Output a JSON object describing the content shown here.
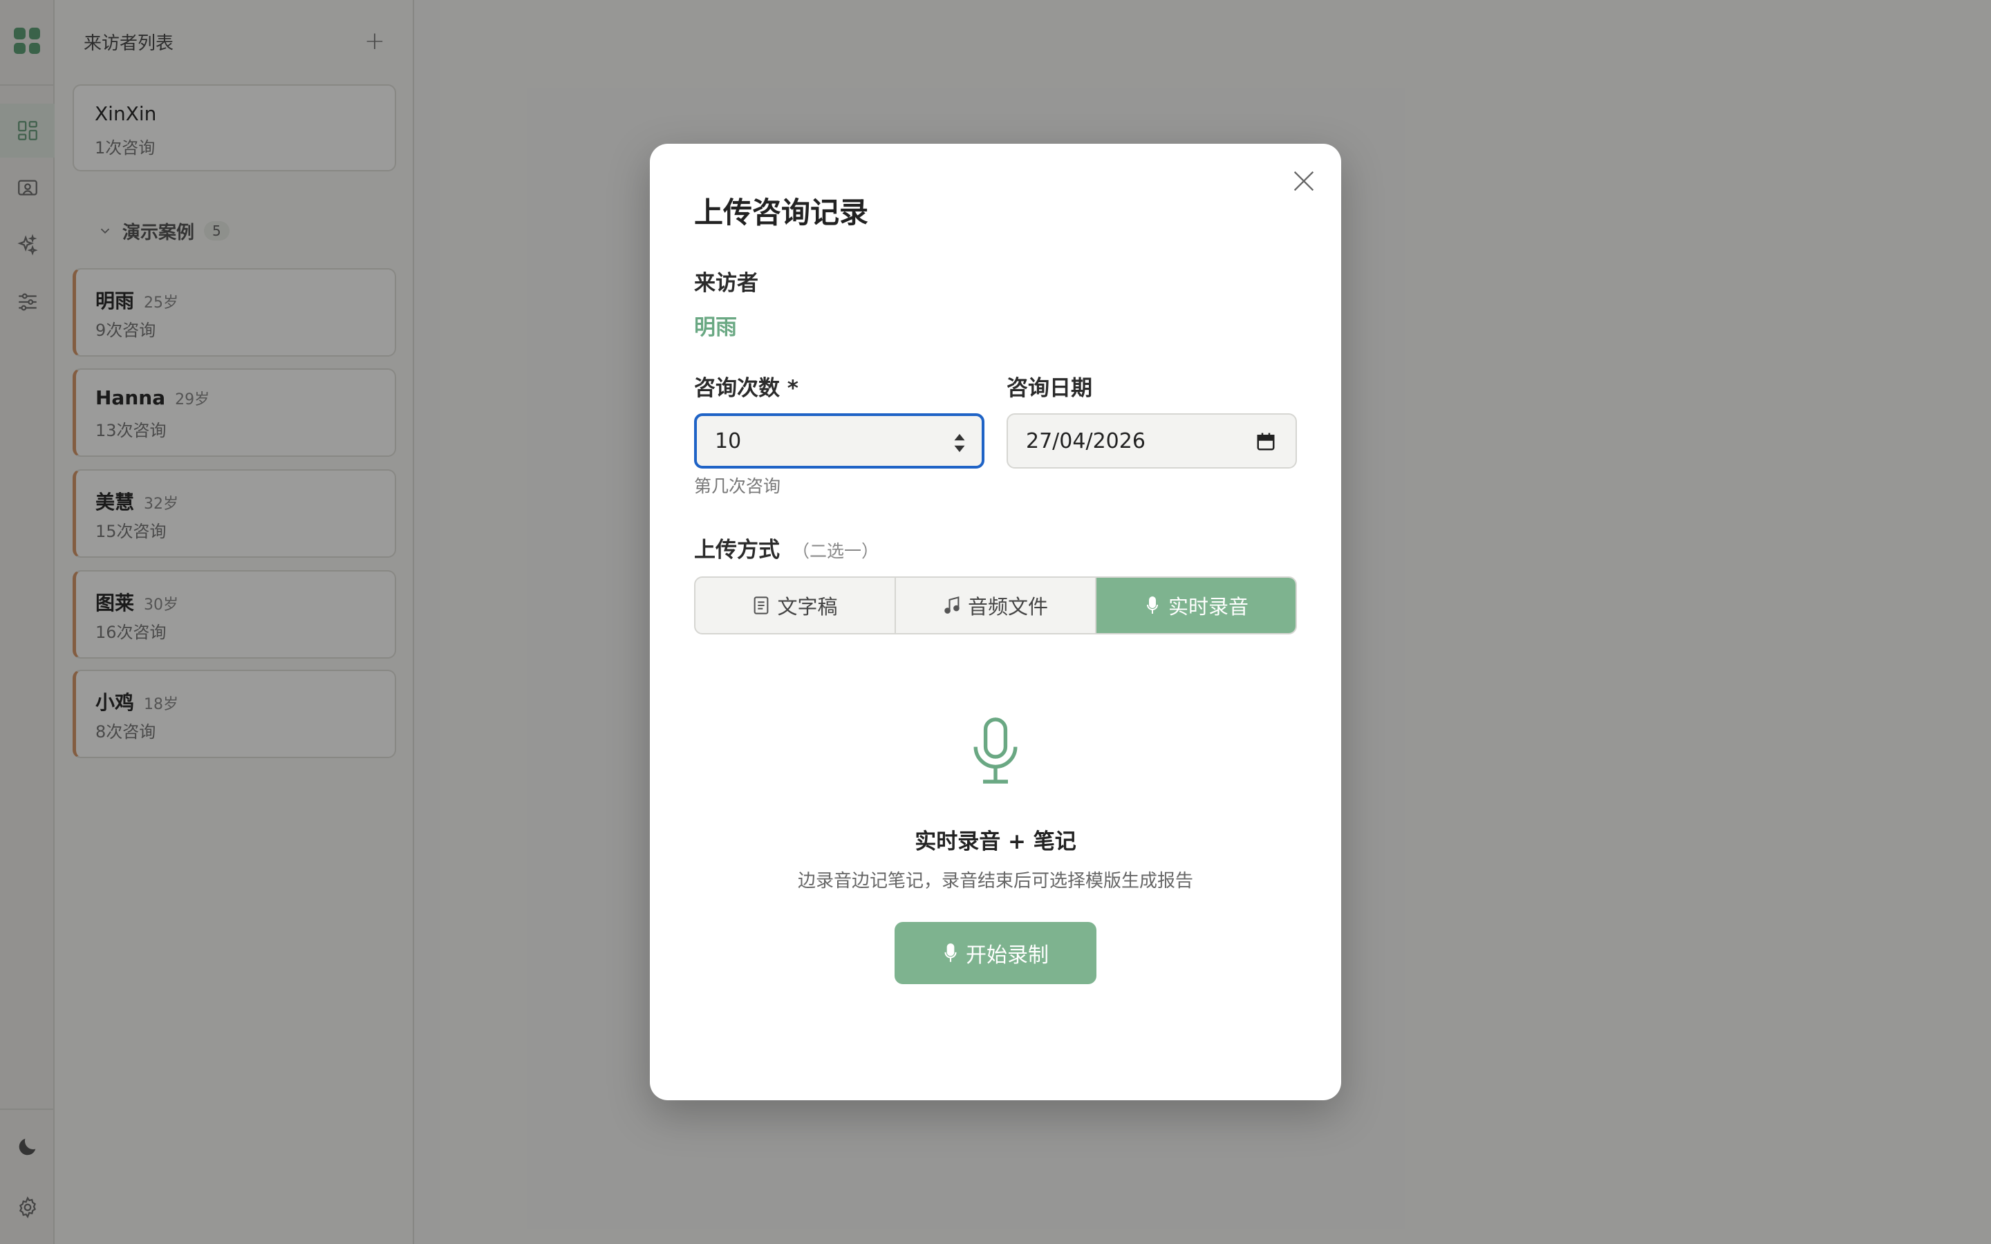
{
  "sidebar": {
    "title": "来访者列表",
    "add_label": "+",
    "top_client": {
      "name": "XinXin",
      "sessions": "1次咨询"
    },
    "group": {
      "label": "演示案例",
      "count": "5"
    },
    "cases": [
      {
        "name": "明雨",
        "age": "25岁",
        "sessions": "9次咨询"
      },
      {
        "name": "Hanna",
        "age": "29岁",
        "sessions": "13次咨询"
      },
      {
        "name": "美慧",
        "age": "32岁",
        "sessions": "15次咨询"
      },
      {
        "name": "图莱",
        "age": "30岁",
        "sessions": "16次咨询"
      },
      {
        "name": "小鸡",
        "age": "18岁",
        "sessions": "8次咨询"
      }
    ]
  },
  "rail": {
    "icons": [
      "grid-logo-icon",
      "dashboard-icon",
      "user-card-icon",
      "sparkle-icon",
      "sliders-icon",
      "moon-icon",
      "settings-gear-icon"
    ]
  },
  "modal": {
    "title": "上传咨询记录",
    "visitor_label": "来访者",
    "visitor_name": "明雨",
    "count_label": "咨询次数 *",
    "count_value": "10",
    "count_hint": "第几次咨询",
    "date_label": "咨询日期",
    "date_value": "27/04/2026",
    "upload_label": "上传方式",
    "upload_sub": "（二选一）",
    "tabs": [
      {
        "label": "文字稿",
        "icon": "document-icon",
        "active": false
      },
      {
        "label": "音频文件",
        "icon": "music-note-icon",
        "active": false
      },
      {
        "label": "实时录音",
        "icon": "microphone-icon",
        "active": true
      }
    ],
    "record_title": "实时录音 + 笔记",
    "record_desc": "边录音边记笔记，录音结束后可选择模版生成报告",
    "start_label": "开始录制"
  },
  "colors": {
    "accent": "#7eb38f",
    "accent_text": "#6aa883",
    "focus_border": "#1f63c6",
    "case_border": "#d4976a"
  }
}
